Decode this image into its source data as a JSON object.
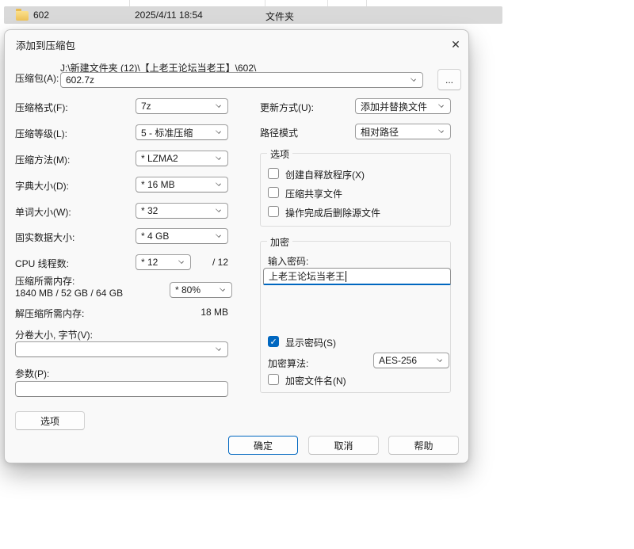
{
  "colors": {
    "accent": "#0067c0",
    "selection_gray": "#d9d9d9",
    "dialog_bg": "#f9f9f9"
  },
  "explorer": {
    "row": {
      "name": "602",
      "date": "2025/4/11 18:54",
      "type": "文件夹"
    }
  },
  "dialog": {
    "title": "添加到压缩包",
    "archive": {
      "label": "压缩包(A):",
      "path": "J:\\新建文件夹 (12)\\【上老王论坛当老王】\\602\\",
      "name": "602.7z",
      "browse_label": "..."
    },
    "left": {
      "format": {
        "label": "压缩格式(F):",
        "value": "7z"
      },
      "level": {
        "label": "压缩等级(L):",
        "value": "5 - 标准压缩"
      },
      "method": {
        "label": "压缩方法(M):",
        "value": "* LZMA2"
      },
      "dict": {
        "label": "字典大小(D):",
        "value": "* 16 MB"
      },
      "word": {
        "label": "单词大小(W):",
        "value": "* 32"
      },
      "solid": {
        "label": "固实数据大小:",
        "value": "* 4 GB"
      },
      "threads": {
        "label": "CPU 线程数:",
        "value": "* 12",
        "suffix": "/ 12"
      },
      "mem_compress": {
        "label": "压缩所需内存:",
        "detail": "1840 MB / 52 GB / 64 GB",
        "value": "* 80%"
      },
      "mem_decompress": {
        "label": "解压缩所需内存:",
        "value": "18 MB"
      },
      "volume": {
        "label": "分卷大小, 字节(V):",
        "value": ""
      },
      "params": {
        "label": "参数(P):",
        "value": ""
      },
      "options_button": "选项"
    },
    "right": {
      "update_mode": {
        "label": "更新方式(U):",
        "value": "添加并替换文件"
      },
      "path_mode": {
        "label": "路径模式",
        "value": "相对路径"
      },
      "options_group": {
        "title": "选项",
        "checkboxes": [
          {
            "label": "创建自释放程序(X)",
            "checked": false
          },
          {
            "label": "压缩共享文件",
            "checked": false
          },
          {
            "label": "操作完成后删除源文件",
            "checked": false
          }
        ]
      },
      "encrypt_group": {
        "title": "加密",
        "password_label": "输入密码:",
        "password_value": "上老王论坛当老王",
        "show_password": {
          "label": "显示密码(S)",
          "checked": true
        },
        "algorithm": {
          "label": "加密算法:",
          "value": "AES-256"
        },
        "encrypt_names": {
          "label": "加密文件名(N)",
          "checked": false
        }
      }
    },
    "footer": {
      "ok": "确定",
      "cancel": "取消",
      "help": "帮助"
    }
  }
}
